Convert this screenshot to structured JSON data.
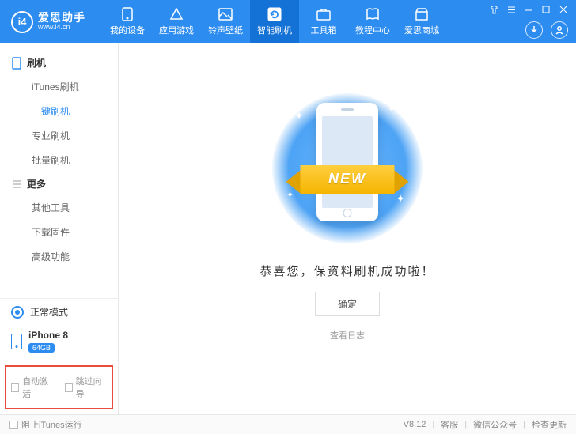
{
  "logo": {
    "glyph": "i4",
    "title": "爱思助手",
    "url": "www.i4.cn"
  },
  "nav": [
    {
      "label": "我的设备"
    },
    {
      "label": "应用游戏"
    },
    {
      "label": "铃声壁纸"
    },
    {
      "label": "智能刷机"
    },
    {
      "label": "工具箱"
    },
    {
      "label": "教程中心"
    },
    {
      "label": "爱思商城"
    }
  ],
  "sidebar": {
    "groups": [
      {
        "title": "刷机",
        "items": [
          "iTunes刷机",
          "一键刷机",
          "专业刷机",
          "批量刷机"
        ]
      },
      {
        "title": "更多",
        "items": [
          "其他工具",
          "下载固件",
          "高级功能"
        ]
      }
    ],
    "mode": "正常模式",
    "device": {
      "name": "iPhone 8",
      "storage": "64GB"
    },
    "checks": {
      "auto": "自动激活",
      "skip": "跳过向导"
    }
  },
  "main": {
    "ribbon": "NEW",
    "message": "恭喜您，保资料刷机成功啦！",
    "ok": "确定",
    "log": "查看日志"
  },
  "footer": {
    "block": "阻止iTunes运行",
    "version": "V8.12",
    "items": [
      "客服",
      "微信公众号",
      "检查更新"
    ]
  }
}
